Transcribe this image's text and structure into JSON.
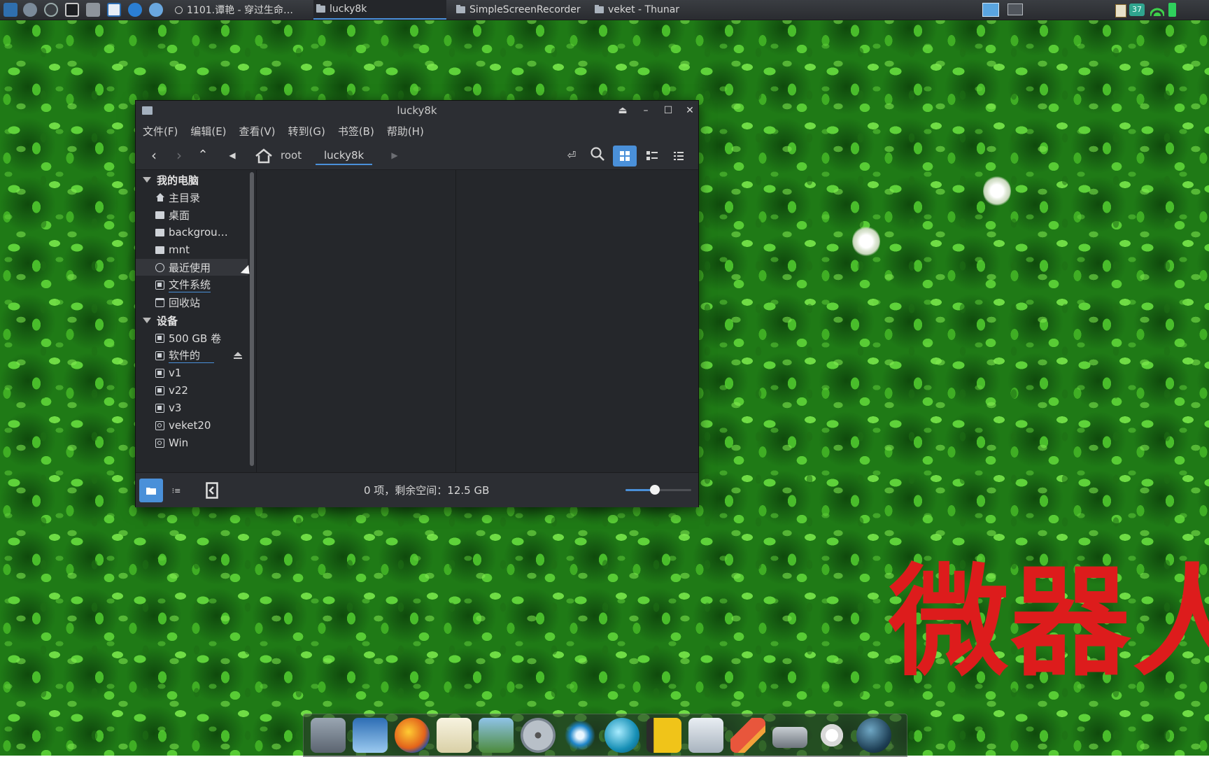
{
  "desktop": {
    "watermark_text": "微器人"
  },
  "top_panel": {
    "tasks": [
      {
        "label": "1101.谭艳 - 穿过生命…",
        "icon": "circle-icon"
      },
      {
        "label": "lucky8k",
        "icon": "folder-icon"
      },
      {
        "label": "SimpleScreenRecorder",
        "icon": "folder-icon"
      },
      {
        "label": "veket - Thunar",
        "icon": "folder-icon"
      }
    ],
    "tray_battery_text": "37"
  },
  "window": {
    "title": "lucky8k",
    "menus": [
      "文件(F)",
      "编辑(E)",
      "查看(V)",
      "转到(G)",
      "书签(B)",
      "帮助(H)"
    ],
    "path": {
      "parent": "root",
      "current": "lucky8k"
    },
    "sidebar": {
      "section_computer": "我的电脑",
      "computer_items": [
        {
          "label": "主目录",
          "icon": "home-icon"
        },
        {
          "label": "桌面",
          "icon": "folder-icon"
        },
        {
          "label": "backgrou…",
          "icon": "folder-icon"
        },
        {
          "label": "mnt",
          "icon": "folder-icon"
        },
        {
          "label": "最近使用",
          "icon": "clock-icon"
        },
        {
          "label": "文件系统",
          "icon": "drive-icon"
        },
        {
          "label": "回收站",
          "icon": "trash-icon"
        }
      ],
      "section_devices": "设备",
      "device_items": [
        {
          "label": "500 GB 卷",
          "icon": "drive-icon"
        },
        {
          "label": "软件的",
          "icon": "drive-icon"
        },
        {
          "label": "v1",
          "icon": "drive-icon"
        },
        {
          "label": "v22",
          "icon": "drive-icon"
        },
        {
          "label": "v3",
          "icon": "drive-icon"
        },
        {
          "label": "veket20",
          "icon": "disk-icon"
        },
        {
          "label": "Win",
          "icon": "disk-icon"
        }
      ]
    },
    "status_text": "0 项，剩余空间：12.5 GB",
    "zoom_level_fraction": 0.45
  },
  "colors": {
    "accent": "#4a90d9",
    "window_bg": "#25272b",
    "watermark": "#dd1c1c"
  },
  "dock": {
    "items": [
      "terminal-icon",
      "monitor-icon",
      "firefox-icon",
      "notepad-icon",
      "image-viewer-icon",
      "disc-icon",
      "network-icon",
      "media-player-icon",
      "book-icon",
      "chart-icon",
      "rocket-icon",
      "drive-icon",
      "settings-icon",
      "globe-icon"
    ]
  }
}
